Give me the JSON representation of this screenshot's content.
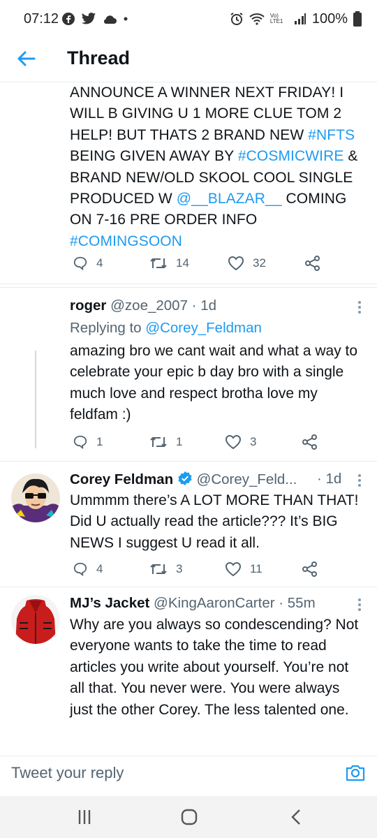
{
  "status_bar": {
    "time": "07:12",
    "battery": "100%",
    "network_label": "Vo) LTE1"
  },
  "header": {
    "title": "Thread"
  },
  "main_tweet": {
    "lines": [
      [
        {
          "t": "ANNOUNCE A WINNER NEXT FRIDAY! I"
        }
      ],
      [
        {
          "t": "WILL B GIVING U 1 MORE CLUE TOM 2"
        }
      ],
      [
        {
          "t": "HELP! BUT THATS 2 BRAND NEW "
        },
        {
          "t": "#NFTS",
          "link": true
        }
      ],
      [
        {
          "t": "BEING GIVEN AWAY BY "
        },
        {
          "t": "#COSMICWIRE",
          "link": true
        },
        {
          "t": " &"
        }
      ],
      [
        {
          "t": "BRAND NEW/OLD SKOOL COOL SINGLE"
        }
      ],
      [
        {
          "t": "PRODUCED W "
        },
        {
          "t": "@__BLAZAR__",
          "link": true
        },
        {
          "t": "  COMING"
        }
      ],
      [
        {
          "t": "ON 7-16 PRE ORDER INFO"
        }
      ],
      [
        {
          "t": "#COMINGSOON",
          "link": true
        }
      ]
    ],
    "replies": "4",
    "retweets": "14",
    "likes": "32"
  },
  "tweets": [
    {
      "name": "roger",
      "handle": "@zoe_2007 · 1d",
      "verified": false,
      "replying_label": "Replying to ",
      "replying_handle": "@Corey_Feldman",
      "text": "amazing bro we cant wait and what a way to celebrate your epic b day bro with a single much love and respect brotha love my feldfam :)",
      "replies": "1",
      "retweets": "1",
      "likes": "3"
    },
    {
      "name": "Corey Feldman",
      "handle": "@Corey_Feld...",
      "time": "· 1d",
      "verified": true,
      "text": "Ummmm there’s A LOT MORE THAN THAT! Did U actually read the article??? It’s BIG NEWS I suggest U read it all.",
      "replies": "4",
      "retweets": "3",
      "likes": "11"
    },
    {
      "name": "MJ’s Jacket",
      "handle": "@KingAaronCarter · 55m",
      "verified": false,
      "text": "Why are you always so condescending? Not everyone wants to take the time to read articles you write about yourself. You’re not all that. You never were. You were always just the other Corey. The less talented one."
    }
  ],
  "reply_bar": {
    "placeholder": "Tweet your reply"
  },
  "colors": {
    "link": "#1d9bf0",
    "secondary_text": "#536471",
    "divider": "#e6ecf0"
  },
  "icons": [
    "back-arrow-icon",
    "reply-icon",
    "retweet-icon",
    "like-icon",
    "share-icon",
    "more-icon",
    "verified-icon",
    "camera-icon",
    "recents-icon",
    "home-icon",
    "back-nav-icon"
  ]
}
